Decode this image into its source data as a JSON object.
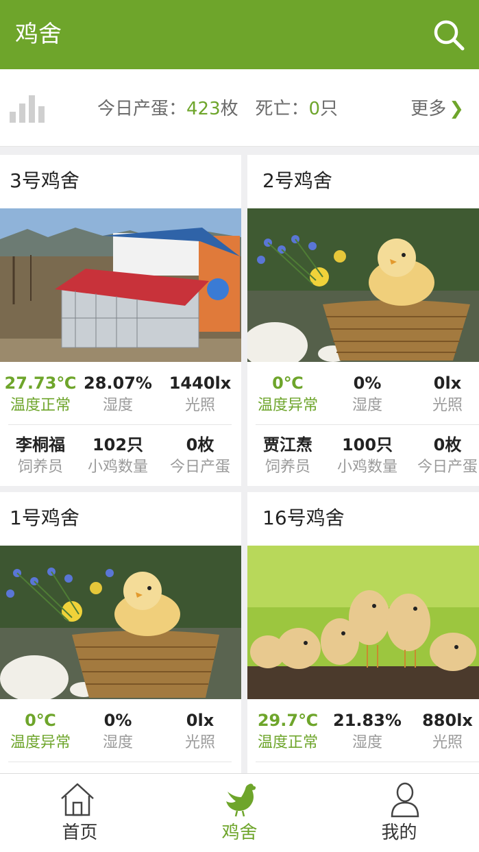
{
  "header": {
    "title": "鸡舍",
    "search_icon": "search-icon"
  },
  "summary": {
    "stats_icon": "bar-chart-icon",
    "egg_label": "今日产蛋：",
    "egg_value": "423",
    "egg_unit": "枚",
    "death_label": "死亡：",
    "death_value": "0",
    "death_unit": "只",
    "more_label": "更多",
    "more_icon": "chevron-right-icon"
  },
  "colors": {
    "accent": "#6ea52b",
    "header_bg": "#6ea52b",
    "muted_text": "#9a9a9a"
  },
  "coops": [
    {
      "name": "3号鸡舍",
      "photo": "coop-house-photo",
      "temperature": "27.73℃",
      "temp_status": "温度正常",
      "humidity": "28.07%",
      "humidity_label": "湿度",
      "light": "1440lx",
      "light_label": "光照",
      "keeper": "李桐福",
      "keeper_label": "饲养员",
      "chicks": "102只",
      "chicks_label": "小鸡数量",
      "eggs": "0枚",
      "eggs_label": "今日产蛋"
    },
    {
      "name": "2号鸡舍",
      "photo": "chick-basket-photo",
      "temperature": "0℃",
      "temp_status": "温度异常",
      "humidity": "0%",
      "humidity_label": "湿度",
      "light": "0lx",
      "light_label": "光照",
      "keeper": "贾江焘",
      "keeper_label": "饲养员",
      "chicks": "100只",
      "chicks_label": "小鸡数量",
      "eggs": "0枚",
      "eggs_label": "今日产蛋"
    },
    {
      "name": "1号鸡舍",
      "photo": "chick-basket-photo",
      "temperature": "0℃",
      "temp_status": "温度异常",
      "humidity": "0%",
      "humidity_label": "湿度",
      "light": "0lx",
      "light_label": "光照"
    },
    {
      "name": "16号鸡舍",
      "photo": "chicks-on-log-photo",
      "temperature": "29.7℃",
      "temp_status": "温度正常",
      "humidity": "21.83%",
      "humidity_label": "湿度",
      "light": "880lx",
      "light_label": "光照"
    }
  ],
  "nav": [
    {
      "label": "首页",
      "icon": "home-icon",
      "active": false
    },
    {
      "label": "鸡舍",
      "icon": "chicken-icon",
      "active": true
    },
    {
      "label": "我的",
      "icon": "user-icon",
      "active": false
    }
  ]
}
